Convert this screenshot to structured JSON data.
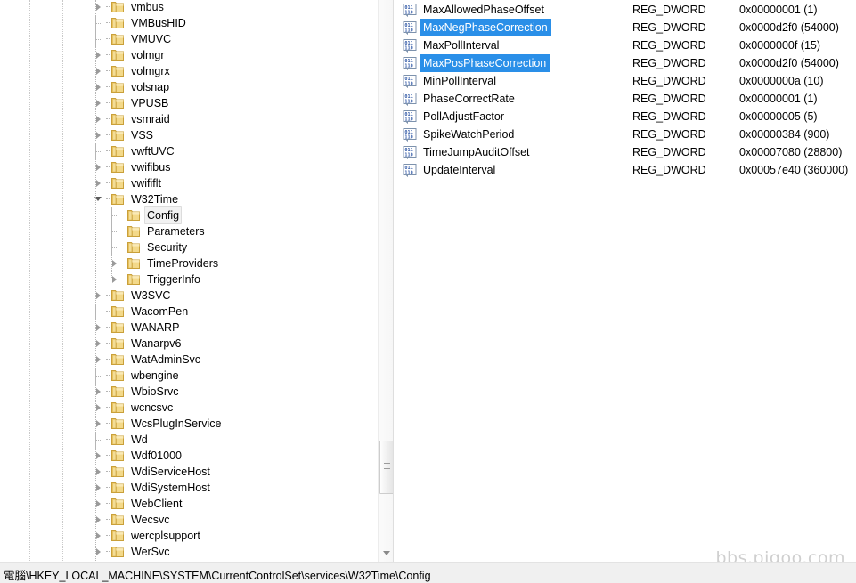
{
  "window": {
    "app": "Registry Editor",
    "watermark": "bbs.pigoo.com"
  },
  "status_bar": {
    "path": "電腦\\HKEY_LOCAL_MACHINE\\SYSTEM\\CurrentControlSet\\services\\W32Time\\Config"
  },
  "tree": {
    "scrollbar": {
      "down_arrow_icon": "chevron-down-icon",
      "thumb_grip_icon": "scrollbar-grip-icon"
    },
    "nodes": [
      {
        "label": "vmbus",
        "depth": 0,
        "state": "collapsed",
        "icon": "folder-icon"
      },
      {
        "label": "VMBusHID",
        "depth": 0,
        "state": "leaf",
        "icon": "folder-icon"
      },
      {
        "label": "VMUVC",
        "depth": 0,
        "state": "leaf",
        "icon": "folder-icon"
      },
      {
        "label": "volmgr",
        "depth": 0,
        "state": "collapsed",
        "icon": "folder-icon"
      },
      {
        "label": "volmgrx",
        "depth": 0,
        "state": "collapsed",
        "icon": "folder-icon"
      },
      {
        "label": "volsnap",
        "depth": 0,
        "state": "collapsed",
        "icon": "folder-icon"
      },
      {
        "label": "VPUSB",
        "depth": 0,
        "state": "collapsed",
        "icon": "folder-icon"
      },
      {
        "label": "vsmraid",
        "depth": 0,
        "state": "collapsed",
        "icon": "folder-icon"
      },
      {
        "label": "VSS",
        "depth": 0,
        "state": "collapsed",
        "icon": "folder-icon"
      },
      {
        "label": "vwftUVC",
        "depth": 0,
        "state": "leaf",
        "icon": "folder-icon"
      },
      {
        "label": "vwifibus",
        "depth": 0,
        "state": "collapsed",
        "icon": "folder-icon"
      },
      {
        "label": "vwififlt",
        "depth": 0,
        "state": "collapsed",
        "icon": "folder-icon"
      },
      {
        "label": "W32Time",
        "depth": 0,
        "state": "expanded",
        "icon": "folder-icon"
      },
      {
        "label": "Config",
        "depth": 1,
        "state": "leaf",
        "icon": "folder-icon",
        "selected": true
      },
      {
        "label": "Parameters",
        "depth": 1,
        "state": "leaf",
        "icon": "folder-icon"
      },
      {
        "label": "Security",
        "depth": 1,
        "state": "leaf",
        "icon": "folder-icon"
      },
      {
        "label": "TimeProviders",
        "depth": 1,
        "state": "collapsed",
        "icon": "folder-icon"
      },
      {
        "label": "TriggerInfo",
        "depth": 1,
        "state": "collapsed",
        "icon": "folder-icon"
      },
      {
        "label": "W3SVC",
        "depth": 0,
        "state": "collapsed",
        "icon": "folder-icon"
      },
      {
        "label": "WacomPen",
        "depth": 0,
        "state": "leaf",
        "icon": "folder-icon"
      },
      {
        "label": "WANARP",
        "depth": 0,
        "state": "collapsed",
        "icon": "folder-icon"
      },
      {
        "label": "Wanarpv6",
        "depth": 0,
        "state": "collapsed",
        "icon": "folder-icon"
      },
      {
        "label": "WatAdminSvc",
        "depth": 0,
        "state": "collapsed",
        "icon": "folder-icon"
      },
      {
        "label": "wbengine",
        "depth": 0,
        "state": "leaf",
        "icon": "folder-icon"
      },
      {
        "label": "WbioSrvc",
        "depth": 0,
        "state": "collapsed",
        "icon": "folder-icon"
      },
      {
        "label": "wcncsvc",
        "depth": 0,
        "state": "collapsed",
        "icon": "folder-icon"
      },
      {
        "label": "WcsPlugInService",
        "depth": 0,
        "state": "collapsed",
        "icon": "folder-icon"
      },
      {
        "label": "Wd",
        "depth": 0,
        "state": "leaf",
        "icon": "folder-icon"
      },
      {
        "label": "Wdf01000",
        "depth": 0,
        "state": "collapsed",
        "icon": "folder-icon"
      },
      {
        "label": "WdiServiceHost",
        "depth": 0,
        "state": "collapsed",
        "icon": "folder-icon"
      },
      {
        "label": "WdiSystemHost",
        "depth": 0,
        "state": "collapsed",
        "icon": "folder-icon"
      },
      {
        "label": "WebClient",
        "depth": 0,
        "state": "collapsed",
        "icon": "folder-icon"
      },
      {
        "label": "Wecsvc",
        "depth": 0,
        "state": "collapsed",
        "icon": "folder-icon"
      },
      {
        "label": "wercplsupport",
        "depth": 0,
        "state": "collapsed",
        "icon": "folder-icon"
      },
      {
        "label": "WerSvc",
        "depth": 0,
        "state": "collapsed",
        "icon": "folder-icon"
      }
    ]
  },
  "values": {
    "icon": "dword-binary-icon",
    "selection_color": "#2a8fe8",
    "rows": [
      {
        "name": "MaxAllowedPhaseOffset",
        "type": "REG_DWORD",
        "data": "0x00000001 (1)",
        "selected": false
      },
      {
        "name": "MaxNegPhaseCorrection",
        "type": "REG_DWORD",
        "data": "0x0000d2f0 (54000)",
        "selected": true
      },
      {
        "name": "MaxPollInterval",
        "type": "REG_DWORD",
        "data": "0x0000000f (15)",
        "selected": false
      },
      {
        "name": "MaxPosPhaseCorrection",
        "type": "REG_DWORD",
        "data": "0x0000d2f0 (54000)",
        "selected": true
      },
      {
        "name": "MinPollInterval",
        "type": "REG_DWORD",
        "data": "0x0000000a (10)",
        "selected": false
      },
      {
        "name": "PhaseCorrectRate",
        "type": "REG_DWORD",
        "data": "0x00000001 (1)",
        "selected": false
      },
      {
        "name": "PollAdjustFactor",
        "type": "REG_DWORD",
        "data": "0x00000005 (5)",
        "selected": false
      },
      {
        "name": "SpikeWatchPeriod",
        "type": "REG_DWORD",
        "data": "0x00000384 (900)",
        "selected": false
      },
      {
        "name": "TimeJumpAuditOffset",
        "type": "REG_DWORD",
        "data": "0x00007080 (28800)",
        "selected": false
      },
      {
        "name": "UpdateInterval",
        "type": "REG_DWORD",
        "data": "0x00057e40 (360000)",
        "selected": false
      }
    ]
  }
}
